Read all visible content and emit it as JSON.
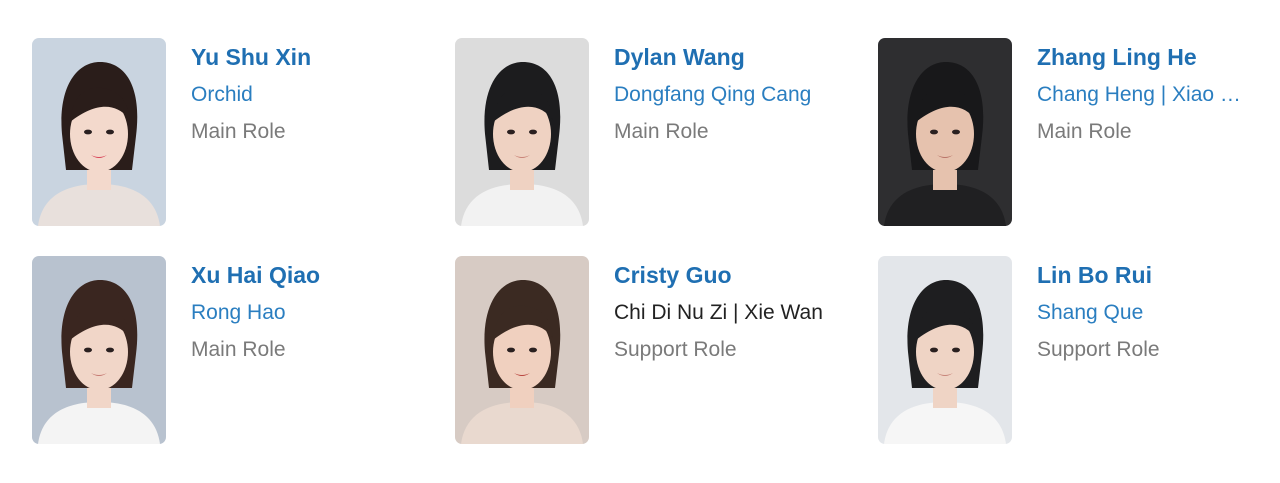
{
  "cast": [
    {
      "name": "Yu Shu Xin",
      "character": "Orchid",
      "character_linked": true,
      "role": "Main Role",
      "photo": {
        "bg": "#c9d4e0",
        "hair": "#2a1d1a",
        "skin": "#f3d9cc",
        "shirt": "#e8e0dc",
        "lips": "#d9475a"
      }
    },
    {
      "name": "Dylan Wang",
      "character": "Dongfang Qing Cang",
      "character_linked": true,
      "role": "Main Role",
      "photo": {
        "bg": "#dcdcdc",
        "hair": "#1c1c1e",
        "skin": "#efd2c2",
        "shirt": "#f2f2f2",
        "lips": "#c98478"
      }
    },
    {
      "name": "Zhang Ling He",
      "character": "Chang Heng | Xiao Ran",
      "character_linked": true,
      "role": "Main Role",
      "photo": {
        "bg": "#2e2e30",
        "hair": "#18181a",
        "skin": "#e6c2ae",
        "shirt": "#202022",
        "lips": "#b97468"
      }
    },
    {
      "name": "Xu Hai Qiao",
      "character": "Rong Hao",
      "character_linked": true,
      "role": "Main Role",
      "photo": {
        "bg": "#b8c2cf",
        "hair": "#3a2620",
        "skin": "#f1d6c8",
        "shirt": "#f4f4f4",
        "lips": "#c67c74"
      }
    },
    {
      "name": "Cristy Guo",
      "character": "Chi Di Nu Zi | Xie Wan",
      "character_linked": false,
      "role": "Support Role",
      "photo": {
        "bg": "#d7cbc4",
        "hair": "#3b2a22",
        "skin": "#f0d0bf",
        "shirt": "#e9d9cf",
        "lips": "#b8453f"
      }
    },
    {
      "name": "Lin Bo Rui",
      "character": "Shang Que",
      "character_linked": true,
      "role": "Support Role",
      "photo": {
        "bg": "#e3e6ea",
        "hair": "#1e1e20",
        "skin": "#efd4c5",
        "shirt": "#f6f6f6",
        "lips": "#c7857a"
      }
    }
  ]
}
